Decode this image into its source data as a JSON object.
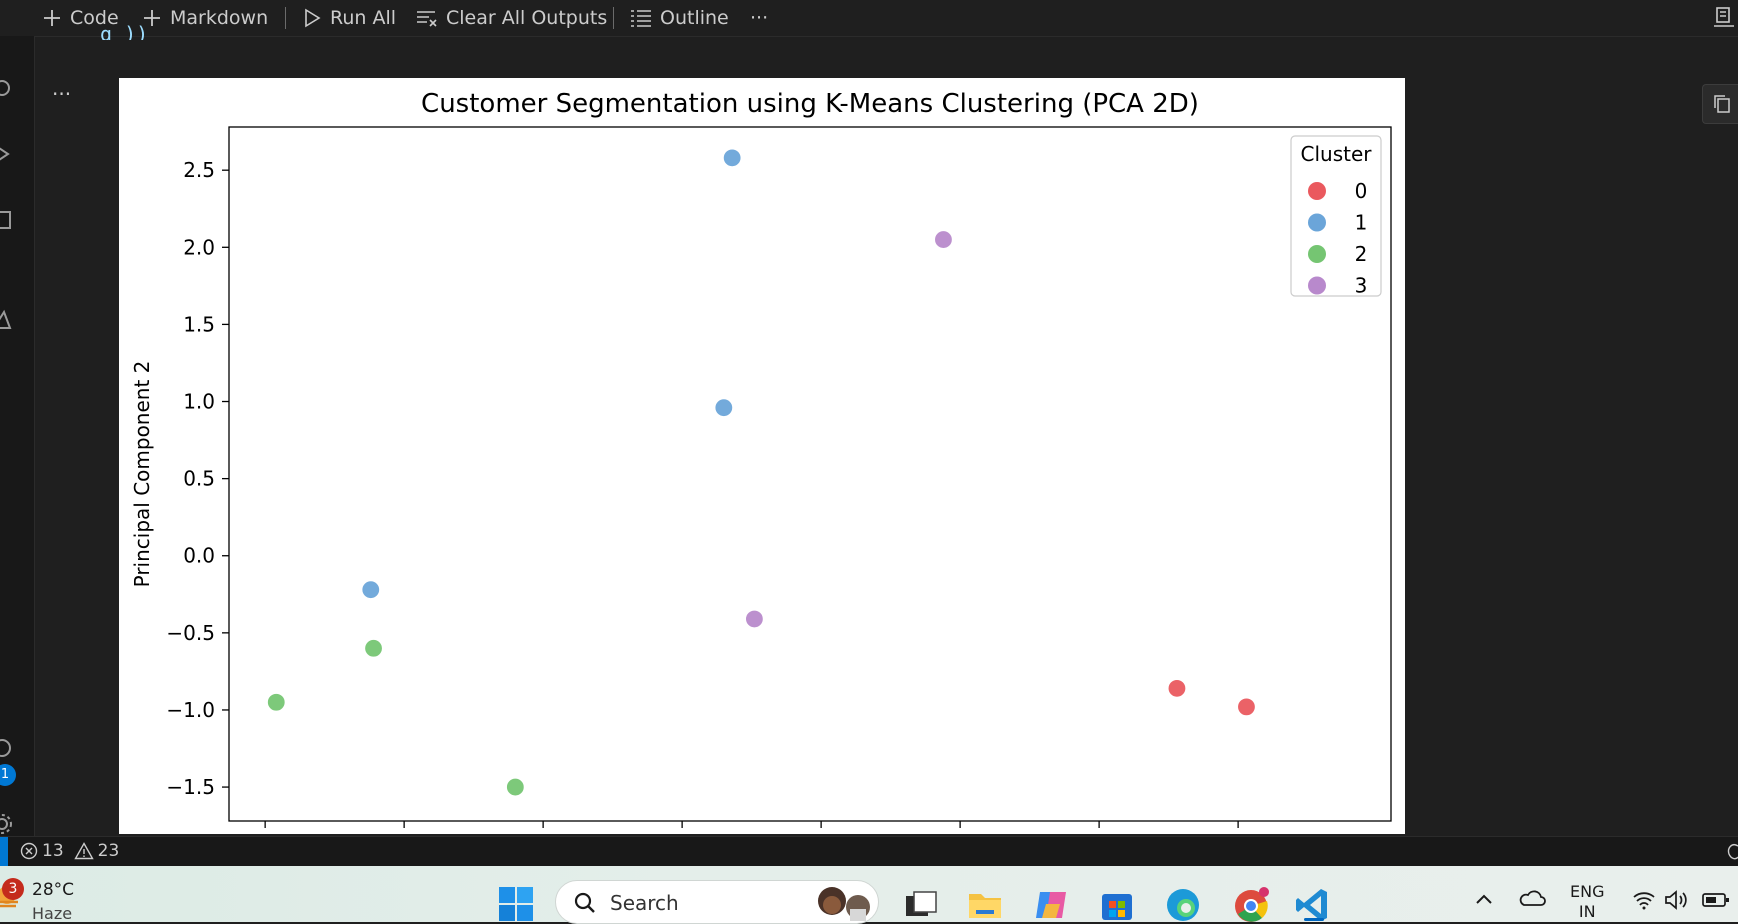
{
  "toolbar": {
    "code_label": "Code",
    "markdown_label": "Markdown",
    "run_all_label": "Run All",
    "clear_outputs_label": "Clear All Outputs",
    "outline_label": "Outline",
    "more_label": "···"
  },
  "cell": {
    "more_label": "...",
    "partial_code": "g           ))"
  },
  "chart_data": {
    "type": "scatter",
    "title": "Customer Segmentation using K-Means Clustering (PCA 2D)",
    "xlabel": "",
    "ylabel": "Principal Component 2",
    "xlim": [
      -2.33,
      1.85
    ],
    "ylim": [
      -1.72,
      2.78
    ],
    "yticks": [
      2.5,
      2.0,
      1.5,
      1.0,
      0.5,
      0.0,
      -0.5,
      -1.0,
      -1.5
    ],
    "ytick_labels": [
      "2.5",
      "2.0",
      "1.5",
      "1.0",
      "0.5",
      "0.0",
      "−0.5",
      "−1.0",
      "−1.5"
    ],
    "xticks": [
      -2.2,
      -1.7,
      -1.2,
      -0.7,
      -0.2,
      0.3,
      0.8,
      1.3
    ],
    "grid": false,
    "legend": {
      "title": "Cluster",
      "position": "top-right",
      "entries": [
        {
          "label": "0",
          "color": "#e8474c"
        },
        {
          "label": "1",
          "color": "#5b9bd5"
        },
        {
          "label": "2",
          "color": "#66bf63"
        },
        {
          "label": "3",
          "color": "#b07cc6"
        }
      ]
    },
    "series": [
      {
        "name": "0",
        "color": "#e8474c",
        "points": [
          [
            1.08,
            -0.86
          ],
          [
            1.33,
            -0.98
          ]
        ]
      },
      {
        "name": "1",
        "color": "#5b9bd5",
        "points": [
          [
            -0.52,
            2.58
          ],
          [
            -0.55,
            0.96
          ],
          [
            -1.82,
            -0.22
          ]
        ]
      },
      {
        "name": "2",
        "color": "#66bf63",
        "points": [
          [
            -2.16,
            -0.95
          ],
          [
            -1.81,
            -0.6
          ],
          [
            -1.3,
            -1.5
          ]
        ]
      },
      {
        "name": "3",
        "color": "#b07cc6",
        "points": [
          [
            0.24,
            2.05
          ],
          [
            -0.44,
            -0.41
          ]
        ]
      }
    ]
  },
  "statusbar": {
    "errors": "13",
    "warnings": "23"
  },
  "activity": {
    "badge": "1"
  },
  "taskbar": {
    "weather_badge": "3",
    "temperature": "28°C",
    "condition": "Haze",
    "search_label": "Search",
    "lang_line1": "ENG",
    "lang_line2": "IN"
  }
}
